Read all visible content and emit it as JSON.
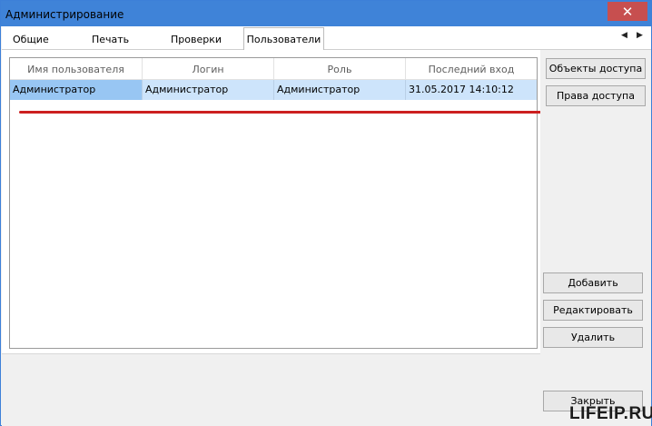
{
  "window": {
    "title": "Администрирование",
    "close_glyph": "✕"
  },
  "tabs": {
    "general": "Общие",
    "print": "Печать",
    "checks": "Проверки",
    "users": "Пользователи",
    "scroll_left": "◀",
    "scroll_right": "▶"
  },
  "grid": {
    "columns": [
      "Имя пользователя",
      "Логин",
      "Роль",
      "Последний вход"
    ],
    "rows": [
      [
        "Администратор",
        "Администратор",
        "Администратор",
        "31.05.2017 14:10:12"
      ]
    ]
  },
  "buttons": {
    "access_objects": "Объекты доступа",
    "access_rights": "Права доступа",
    "add": "Добавить",
    "edit": "Редактировать",
    "delete": "Удалить",
    "close": "Закрыть"
  },
  "watermark": "LIFEIP.RU",
  "colors": {
    "titlebar": "#3f83d8",
    "close_button": "#c74f4f",
    "selected_row": "#cde4fb",
    "selected_cell": "#98c6f3",
    "annotation_underline": "#cc1f1f"
  }
}
